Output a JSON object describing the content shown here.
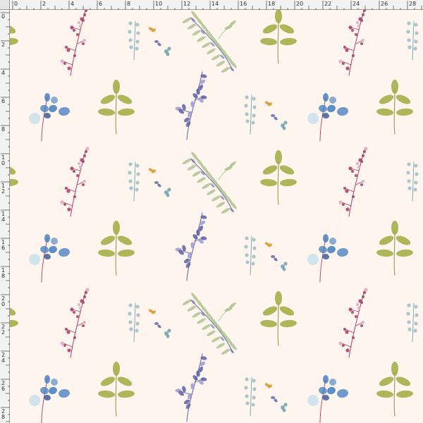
{
  "colors": {
    "background": "#fdf5ee",
    "pink": "#b0406a",
    "pink_light": "#e6a8c2",
    "lavender": "#5c5fa5",
    "lavender_light": "#9c9ad3",
    "teal": "#73a7b3",
    "teal_dark": "#4f8ea0",
    "olive": "#9fac3f",
    "olive_stem": "#a0a063",
    "blue": "#3f7bbf",
    "blue_light": "#cde2ea",
    "orange": "#d99a2a",
    "fern": "#9fba7e",
    "fern_dark": "#6c6aa8",
    "ruler_bg": "#f2f2f2",
    "ruler_line": "#9a9a9a"
  },
  "ruler": {
    "unit_step": 2,
    "max": 28,
    "labels_top": [
      "0",
      "2",
      "4",
      "6",
      "8",
      "10",
      "12",
      "14",
      "16",
      "18",
      "20",
      "22",
      "24",
      "26",
      "28"
    ],
    "labels_left": [
      "0",
      "2",
      "4",
      "6",
      "8",
      "10",
      "12",
      "14",
      "16",
      "18",
      "20",
      "22",
      "24",
      "26",
      "28"
    ]
  },
  "pattern": {
    "rows": [
      "pink-sprig",
      "olive-leaf",
      "lavender-sprig",
      "teal-sprig",
      "blue-petals",
      "fern-spray"
    ]
  }
}
